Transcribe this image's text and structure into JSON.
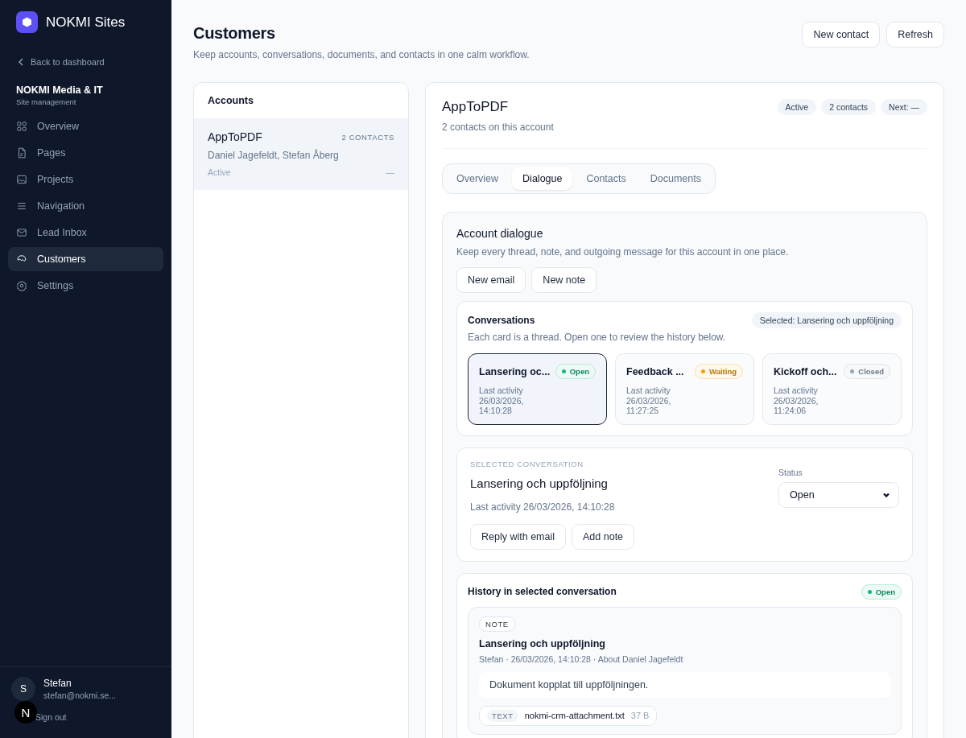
{
  "sidebar": {
    "brand": "NOKMI Sites",
    "back": "Back to dashboard",
    "org": {
      "name": "NOKMI Media & IT",
      "subtitle": "Site management"
    },
    "items": [
      {
        "label": "Overview",
        "selected": false
      },
      {
        "label": "Pages",
        "selected": false
      },
      {
        "label": "Projects",
        "selected": false
      },
      {
        "label": "Navigation",
        "selected": false
      },
      {
        "label": "Lead Inbox",
        "selected": false
      },
      {
        "label": "Customers",
        "selected": true
      },
      {
        "label": "Settings",
        "selected": false
      }
    ],
    "user": {
      "initial": "S",
      "name": "Stefan",
      "email": "stefan@nokmi.se..."
    },
    "sign_out": "Sign out",
    "dev_badge": "N"
  },
  "header": {
    "title": "Customers",
    "subtitle": "Keep accounts, conversations, documents, and contacts in one calm workflow.",
    "buttons": [
      "New contact",
      "Refresh"
    ]
  },
  "accounts": {
    "title": "Accounts",
    "items": [
      {
        "name": "AppToPDF",
        "count": "2 CONTACTS",
        "contacts": "Daniel Jagefeldt, Stefan Åberg",
        "status": "Active",
        "next": "—",
        "selected": true
      }
    ]
  },
  "detail": {
    "title": "AppToPDF",
    "subtitle": "2 contacts on this account",
    "chips": [
      "Active",
      "2 contacts",
      "Next: —"
    ],
    "tabs": [
      {
        "label": "Overview",
        "selected": false
      },
      {
        "label": "Dialogue",
        "selected": true
      },
      {
        "label": "Contacts",
        "selected": false
      },
      {
        "label": "Documents",
        "selected": false
      }
    ],
    "dialogue": {
      "title": "Account dialogue",
      "subtitle": "Keep every thread, note, and outgoing message for this account in one place.",
      "buttons": [
        "New email",
        "New note"
      ],
      "conversations": {
        "title": "Conversations",
        "subtitle": "Each card is a thread. Open one to review the history below.",
        "selected_chip": "Selected: Lansering och uppföljning",
        "items": [
          {
            "title": "Lansering oc...",
            "status": "Open",
            "color": "#10b981",
            "label": "Last activity",
            "date": "26/03/2026,",
            "time": "14:10:28",
            "selected": true
          },
          {
            "title": "Feedback ...",
            "status": "Waiting",
            "color": "#f59e0b",
            "label": "Last activity",
            "date": "26/03/2026,",
            "time": "11:27:25",
            "selected": false
          },
          {
            "title": "Kickoff och...",
            "status": "Closed",
            "color": "#94a3b8",
            "label": "Last activity",
            "date": "26/03/2026,",
            "time": "11:24:06",
            "selected": false
          }
        ]
      },
      "selected_conversation": {
        "eyebrow": "SELECTED CONVERSATION",
        "title": "Lansering och uppföljning",
        "activity": "Last activity 26/03/2026, 14:10:28",
        "status_label": "Status",
        "status_value": "Open",
        "buttons": [
          "Reply with email",
          "Add note"
        ]
      },
      "history": {
        "title": "History in selected conversation",
        "status": "Open",
        "color": "#10b981",
        "entries": [
          {
            "kind": "NOTE",
            "title": "Lansering och uppföljning",
            "meta": "Stefan · 26/03/2026, 14:10:28 · About Daniel Jagefeldt",
            "body": "Dokument kopplat till uppföljningen.",
            "attachments": [
              {
                "type": "TEXT",
                "name": "nokmi-crm-attachment.txt",
                "size": "37 B"
              }
            ]
          }
        ]
      }
    }
  }
}
